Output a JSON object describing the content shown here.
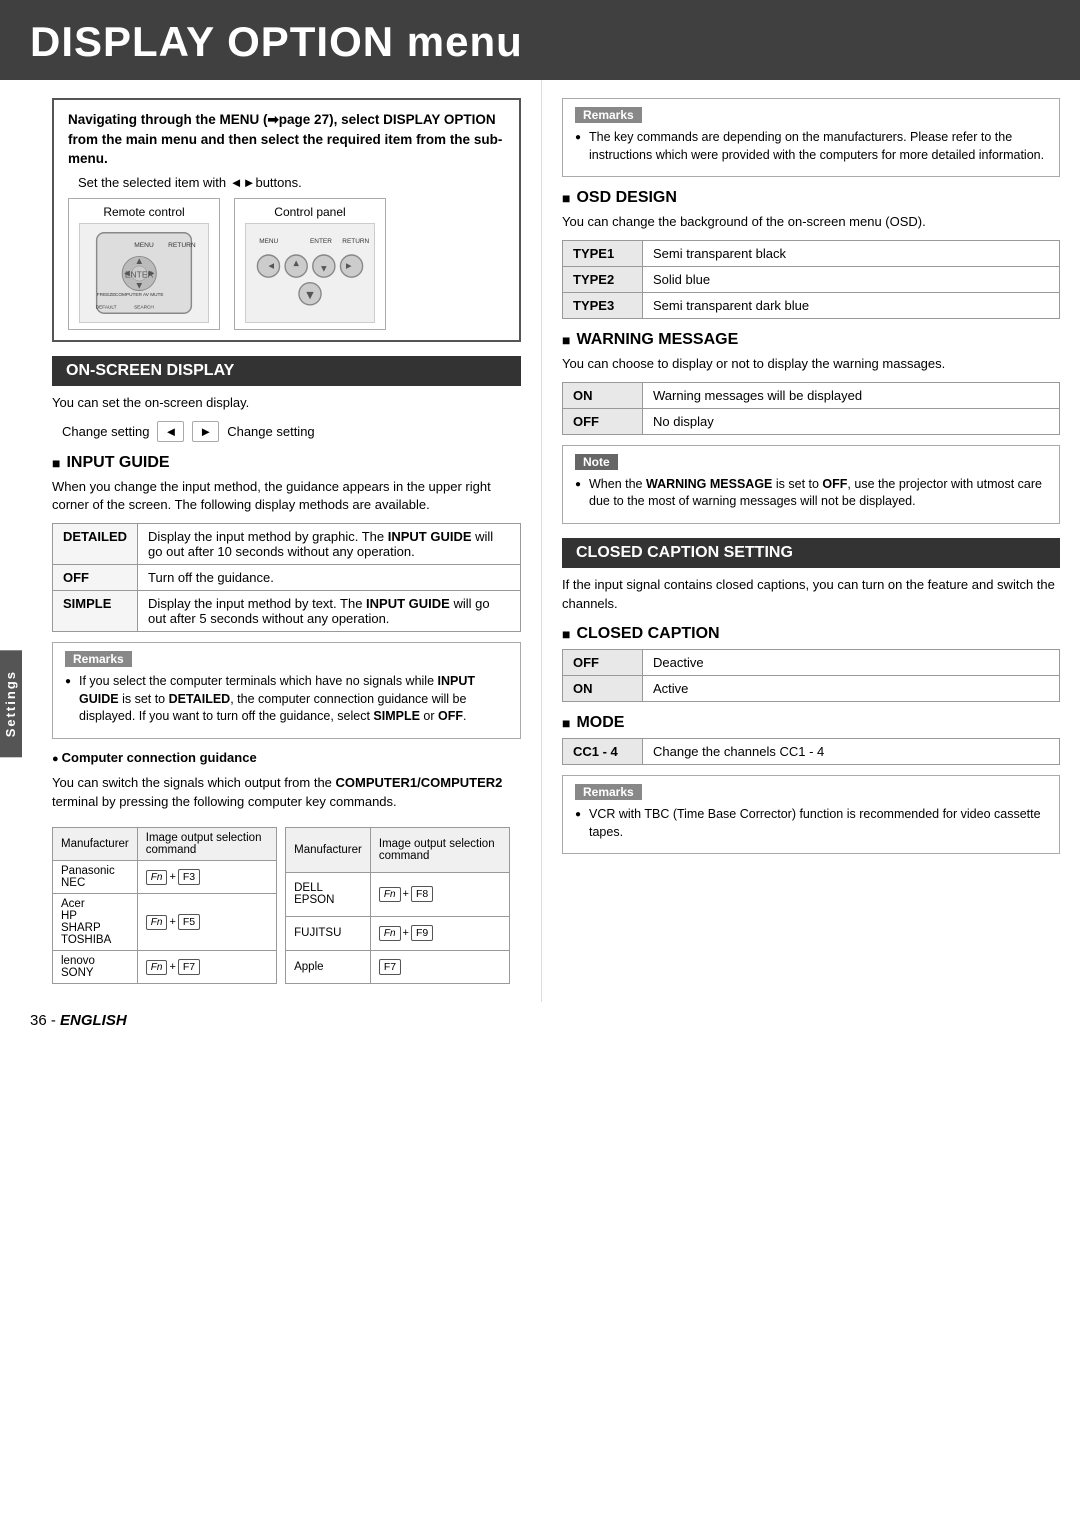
{
  "header": {
    "title": "DISPLAY OPTION menu"
  },
  "intro": {
    "text": "Navigating through the MENU (➡page 27), select DISPLAY OPTION from the main menu and then select the required item from the sub-menu.",
    "bullet": "Set the selected item with ◄►buttons.",
    "remote_label": "Remote control",
    "panel_label": "Control panel"
  },
  "on_screen_display": {
    "title": "ON-SCREEN DISPLAY",
    "body": "You can set the on-screen display.",
    "change_setting_left": "Change setting",
    "change_setting_right": "Change setting"
  },
  "input_guide": {
    "title": "INPUT GUIDE",
    "body": "When you change the input method, the guidance appears in the upper right corner of the screen. The following display methods are available.",
    "table": [
      {
        "key": "DETAILED",
        "value": "Display the input method by graphic. The INPUT GUIDE will go out after 10 seconds without any operation."
      },
      {
        "key": "OFF",
        "value": "Turn off the guidance."
      },
      {
        "key": "SIMPLE",
        "value": "Display the input method by text. The INPUT GUIDE will go out after 5 seconds without any operation."
      }
    ],
    "remarks": {
      "title": "Remarks",
      "items": [
        "If you select the computer terminals which have no signals while INPUT GUIDE is set to DETAILED, the computer connection guidance will be displayed. If you want to turn off the guidance, select SIMPLE or OFF."
      ]
    }
  },
  "computer_connection": {
    "title": "Computer connection guidance",
    "body1": "You can switch the signals which output from the COMPUTER1/COMPUTER2 terminal by pressing the following computer key commands.",
    "col1_header1": "Manufacturer",
    "col1_header2": "Image output selection command",
    "col2_header1": "Manufacturer",
    "col2_header2": "Image output selection command",
    "rows1": [
      {
        "mfr": "Panasonic\nNEC",
        "cmd": "Fn+F3"
      },
      {
        "mfr": "Acer\nHP\nSHARP\nTOSHIBA",
        "cmd": "Fn+F5"
      },
      {
        "mfr": "lenovo\nSONY",
        "cmd": "Fn+F7"
      }
    ],
    "rows2": [
      {
        "mfr": "DELL\nEPSON",
        "cmd": "Fn+F8"
      },
      {
        "mfr": "FUJITSU",
        "cmd": "Fn+F9"
      },
      {
        "mfr": "Apple",
        "cmd": "F7"
      }
    ]
  },
  "remarks_right": {
    "title": "Remarks",
    "items": [
      "The key commands are depending on the manufacturers. Please refer to the instructions which were provided with the computers for more detailed information."
    ]
  },
  "osd_design": {
    "title": "OSD DESIGN",
    "body": "You can change the background of the on-screen menu (OSD).",
    "table": [
      {
        "key": "TYPE1",
        "value": "Semi transparent black"
      },
      {
        "key": "TYPE2",
        "value": "Solid blue"
      },
      {
        "key": "TYPE3",
        "value": "Semi transparent dark blue"
      }
    ]
  },
  "warning_message": {
    "title": "WARNING MESSAGE",
    "body": "You can choose to display or not to display the warning massages.",
    "table": [
      {
        "key": "ON",
        "value": "Warning messages will be displayed"
      },
      {
        "key": "OFF",
        "value": "No display"
      }
    ],
    "note": {
      "title": "Note",
      "items": [
        "When the WARNING MESSAGE is set to OFF, use the projector with utmost care due to the most of warning messages will not be displayed."
      ]
    }
  },
  "closed_caption_setting": {
    "title": "CLOSED CAPTION SETTING",
    "body": "If the input signal contains closed captions, you can turn on the feature and switch the channels."
  },
  "closed_caption": {
    "title": "CLOSED CAPTION",
    "table": [
      {
        "key": "OFF",
        "value": "Deactive"
      },
      {
        "key": "ON",
        "value": "Active"
      }
    ]
  },
  "mode": {
    "title": "MODE",
    "table": [
      {
        "key": "CC1 - 4",
        "value": "Change the channels CC1 - 4"
      }
    ],
    "remarks": {
      "title": "Remarks",
      "items": [
        "VCR with TBC (Time Base Corrector) function is recommended for video cassette tapes."
      ]
    }
  },
  "sidebar": {
    "label": "Settings"
  },
  "footer": {
    "text": "36 - English",
    "prefix": "36 - ",
    "suffix": "ENGLISH"
  }
}
